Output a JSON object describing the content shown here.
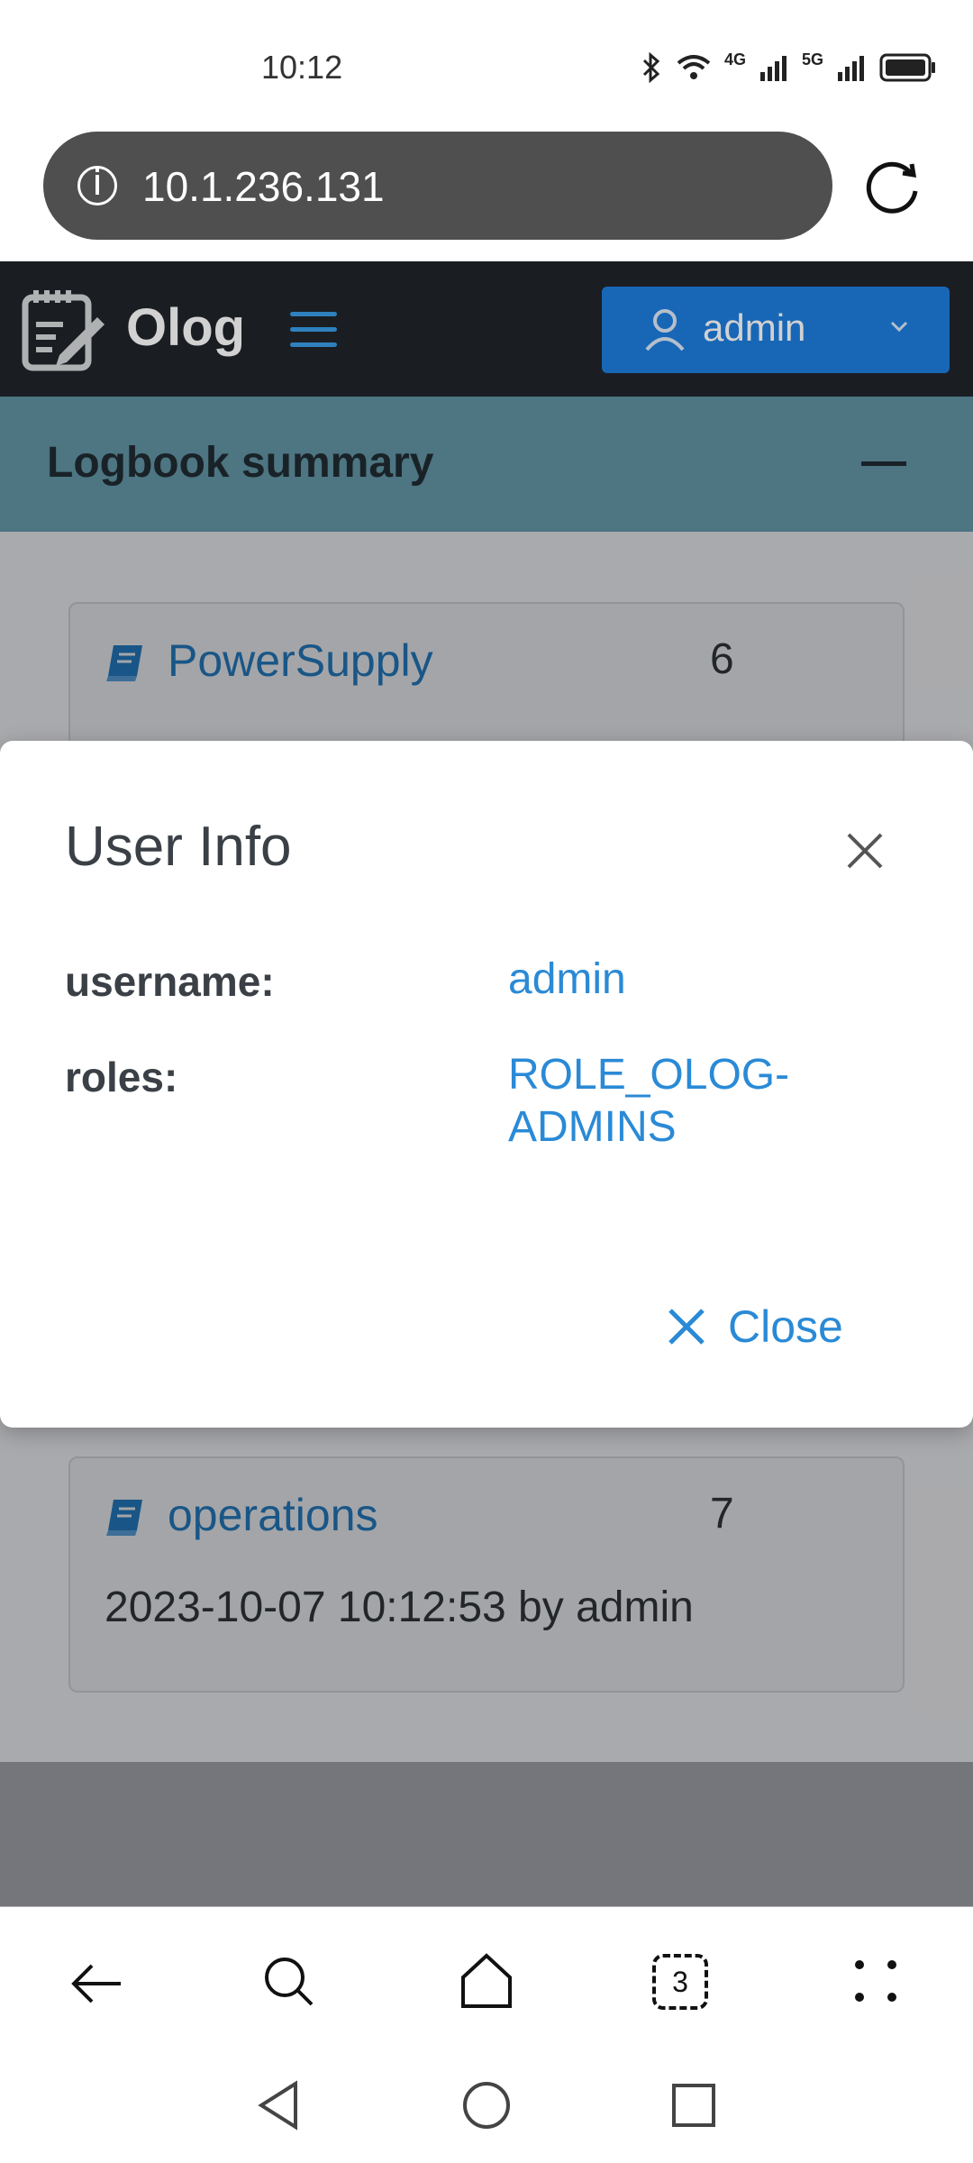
{
  "status_bar": {
    "time": "10:12",
    "net1": "4G",
    "net2": "5G"
  },
  "browser": {
    "url": "10.1.236.131",
    "tab_count": "3"
  },
  "app": {
    "brand": "Olog",
    "user_button": "admin"
  },
  "summary": {
    "title": "Logbook summary",
    "cards": [
      {
        "name": "PowerSupply",
        "count": "6",
        "meta": ""
      },
      {
        "name": "operations",
        "count": "7",
        "meta": "2023-10-07 10:12:53 by admin"
      }
    ]
  },
  "modal": {
    "title": "User Info",
    "fields": [
      {
        "label": "username:",
        "value": "admin"
      },
      {
        "label": "roles:",
        "value": "ROLE_OLOG-ADMINS"
      }
    ],
    "close_label": "Close"
  },
  "colors": {
    "accent": "#1e7ee0",
    "link": "#2a8ad6",
    "navbar": "#20252b",
    "summary_header": "#5f8f9f"
  }
}
